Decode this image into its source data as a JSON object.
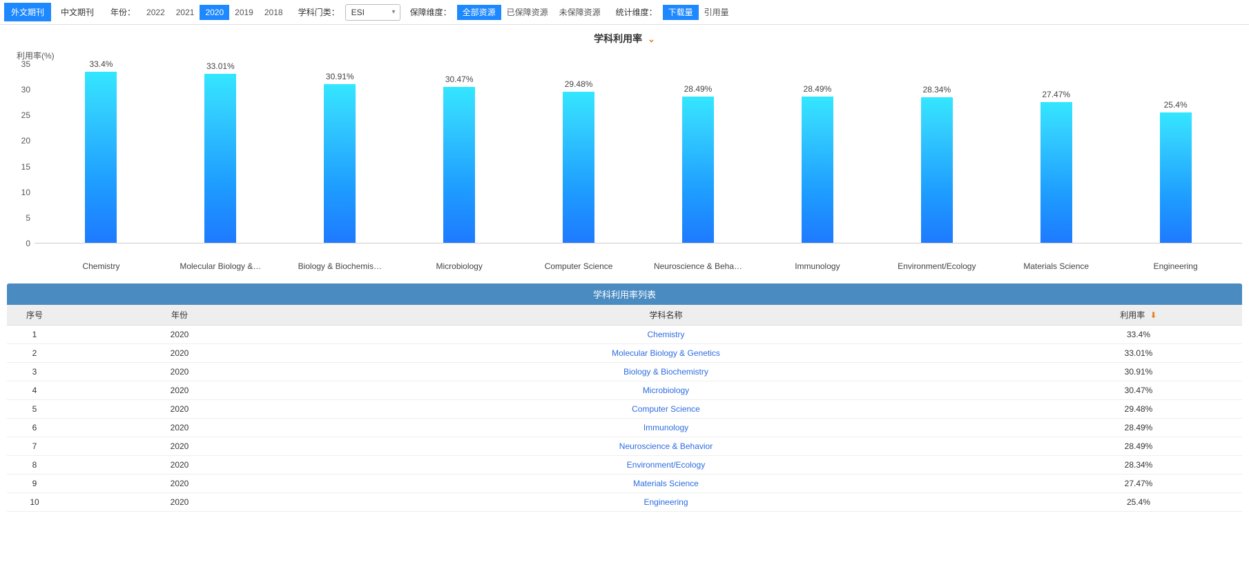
{
  "toolbar": {
    "tab_foreign": "外文期刊",
    "tab_chinese": "中文期刊",
    "year_label": "年份：",
    "years": [
      "2022",
      "2021",
      "2020",
      "2019",
      "2018"
    ],
    "year_active": "2020",
    "subject_cat_label": "学科门类：",
    "subject_cat_value": "ESI",
    "guarantee_label": "保障维度：",
    "guarantee_opts": [
      "全部资源",
      "已保障资源",
      "未保障资源"
    ],
    "guarantee_active": "全部资源",
    "stat_label": "统计维度：",
    "stat_opts": [
      "下载量",
      "引用量"
    ],
    "stat_active": "下载量"
  },
  "chart_section_title": "学科利用率",
  "chart_data": {
    "type": "bar",
    "ylabel": "利用率(%)",
    "ylim": [
      0,
      35
    ],
    "yticks": [
      0,
      5,
      10,
      15,
      20,
      25,
      30,
      35
    ],
    "categories": [
      "Chemistry",
      "Molecular Biology & Genetics",
      "Biology & Biochemistry",
      "Microbiology",
      "Computer Science",
      "Neuroscience & Behavior",
      "Immunology",
      "Environment/Ecology",
      "Materials Science",
      "Engineering"
    ],
    "categories_display": [
      "Chemistry",
      "Molecular Biology &…",
      "Biology & Biochemis…",
      "Microbiology",
      "Computer Science",
      "Neuroscience & Beha…",
      "Immunology",
      "Environment/Ecology",
      "Materials Science",
      "Engineering"
    ],
    "values": [
      33.4,
      33.01,
      30.91,
      30.47,
      29.48,
      28.49,
      28.49,
      28.34,
      27.47,
      25.4
    ],
    "value_labels": [
      "33.4%",
      "33.01%",
      "30.91%",
      "30.47%",
      "29.48%",
      "28.49%",
      "28.49%",
      "28.34%",
      "27.47%",
      "25.4%"
    ]
  },
  "table": {
    "title": "学科利用率列表",
    "headers": {
      "seq": "序号",
      "year": "年份",
      "subject": "学科名称",
      "rate": "利用率"
    },
    "rows": [
      {
        "seq": "1",
        "year": "2020",
        "subject": "Chemistry",
        "rate": "33.4%"
      },
      {
        "seq": "2",
        "year": "2020",
        "subject": "Molecular Biology & Genetics",
        "rate": "33.01%"
      },
      {
        "seq": "3",
        "year": "2020",
        "subject": "Biology & Biochemistry",
        "rate": "30.91%"
      },
      {
        "seq": "4",
        "year": "2020",
        "subject": "Microbiology",
        "rate": "30.47%"
      },
      {
        "seq": "5",
        "year": "2020",
        "subject": "Computer Science",
        "rate": "29.48%"
      },
      {
        "seq": "6",
        "year": "2020",
        "subject": "Immunology",
        "rate": "28.49%"
      },
      {
        "seq": "7",
        "year": "2020",
        "subject": "Neuroscience & Behavior",
        "rate": "28.49%"
      },
      {
        "seq": "8",
        "year": "2020",
        "subject": "Environment/Ecology",
        "rate": "28.34%"
      },
      {
        "seq": "9",
        "year": "2020",
        "subject": "Materials Science",
        "rate": "27.47%"
      },
      {
        "seq": "10",
        "year": "2020",
        "subject": "Engineering",
        "rate": "25.4%"
      }
    ]
  }
}
